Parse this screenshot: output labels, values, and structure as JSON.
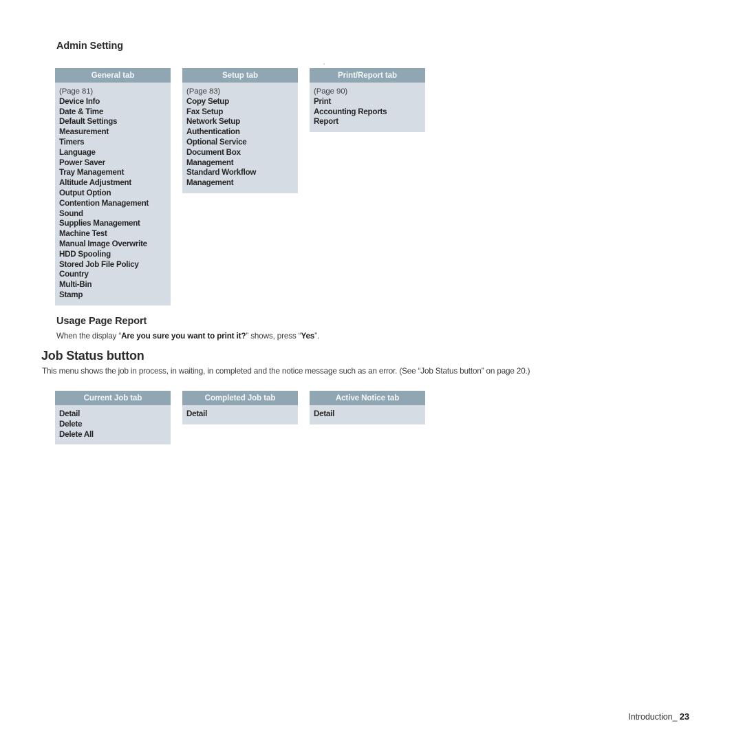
{
  "page": {
    "footer_label": "Introduction_",
    "footer_page": "23"
  },
  "admin_setting": {
    "heading": "Admin Setting",
    "columns": [
      {
        "header": "General tab",
        "page_ref": "(Page 81)",
        "items": [
          "Device Info",
          "Date & Time",
          "Default Settings",
          "Measurement",
          "Timers",
          "Language",
          "Power Saver",
          "Tray Management",
          "Altitude Adjustment",
          "Output Option",
          "Contention Management",
          "Sound",
          "Supplies Management",
          "Machine Test",
          "Manual Image Overwrite",
          "HDD Spooling",
          "Stored Job File Policy",
          "Country",
          "Multi-Bin",
          "Stamp"
        ]
      },
      {
        "header": "Setup tab",
        "page_ref": "(Page 83)",
        "items": [
          "Copy Setup",
          "Fax Setup",
          "Network Setup",
          "Authentication",
          "Optional Service",
          "Document Box",
          "Management",
          "Standard Workflow",
          "Management"
        ]
      },
      {
        "header": "Print/Report tab",
        "page_ref": "(Page 90)",
        "items": [
          "Print",
          "Accounting Reports",
          "Report"
        ]
      }
    ]
  },
  "usage_page_report": {
    "heading": "Usage Page Report",
    "text_part1": "When the display “",
    "text_bold1": "Are you sure you want to print it?",
    "text_part2": "” shows, press “",
    "text_bold2": "Yes",
    "text_part3": "”."
  },
  "job_status": {
    "heading": "Job Status button",
    "description": "This menu shows the job in process, in waiting, in completed and the notice message such as an error. (See “Job Status button” on page 20.)",
    "columns": [
      {
        "header": "Current Job tab",
        "items": [
          "Detail",
          "Delete",
          "Delete All"
        ]
      },
      {
        "header": "Completed Job tab",
        "items": [
          "Detail"
        ]
      },
      {
        "header": "Active Notice tab",
        "items": [
          "Detail"
        ]
      }
    ]
  }
}
